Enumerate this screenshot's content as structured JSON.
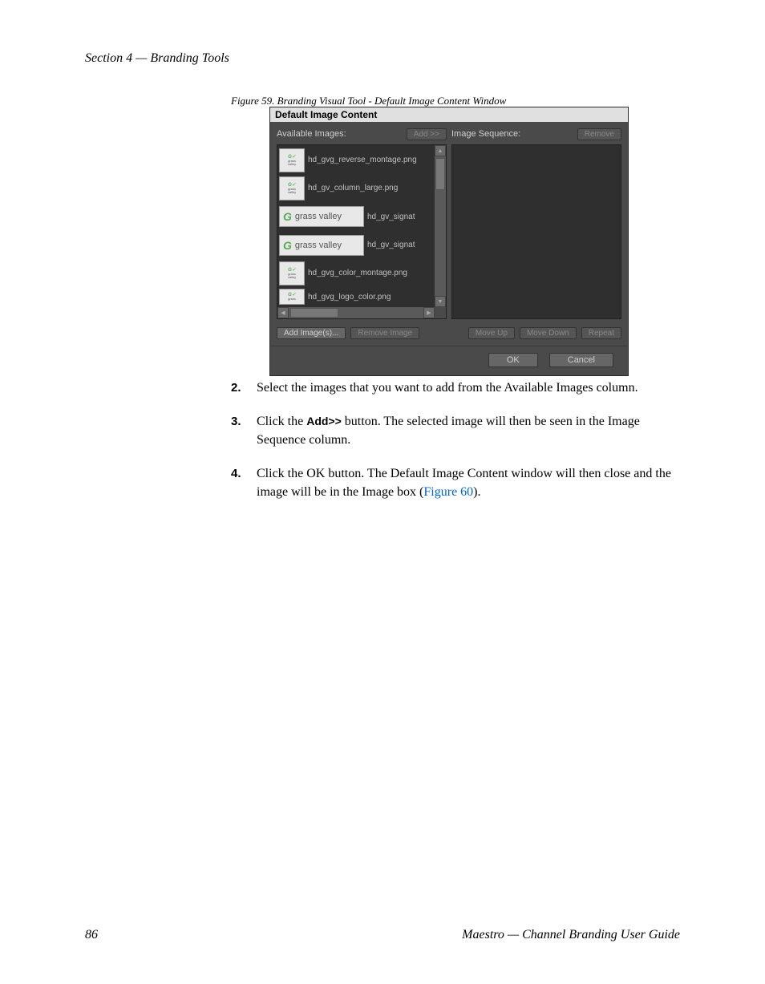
{
  "header": "Section 4 — Branding Tools",
  "figure_caption": "Figure 59.  Branding Visual Tool - Default Image Content Window",
  "dialog": {
    "title": "Default Image Content",
    "left": {
      "label": "Available Images:",
      "add_btn": "Add >>",
      "images": [
        {
          "name": "hd_gvg_reverse_montage.png",
          "style": "small"
        },
        {
          "name": "hd_gv_column_large.png",
          "style": "small"
        },
        {
          "name": "hd_gv_signat",
          "style": "wide",
          "brand": "grass valley"
        },
        {
          "name": "hd_gv_signat",
          "style": "wide",
          "brand": "grass valley"
        },
        {
          "name": "hd_gvg_color_montage.png",
          "style": "small"
        },
        {
          "name": "hd_gvg_logo_color.png",
          "style": "small"
        }
      ],
      "add_image_btn": "Add Image(s)...",
      "remove_image_btn": "Remove Image"
    },
    "right": {
      "label": "Image Sequence:",
      "remove_btn": "Remove",
      "move_up_btn": "Move Up",
      "move_down_btn": "Move Down",
      "repeat_btn": "Repeat"
    },
    "footer": {
      "ok": "OK",
      "cancel": "Cancel"
    }
  },
  "steps": [
    {
      "num": "2.",
      "text_a": "Select the images that you want to add from the Available Images column."
    },
    {
      "num": "3.",
      "text_a": "Click the ",
      "bold": "Add>>",
      "text_b": " button. The selected image will then be seen in the Image Sequence column."
    },
    {
      "num": "4.",
      "text_a": "Click the OK button. The Default Image Content window will then close and the image will be in the Image box (",
      "link": "Figure 60",
      "text_b": ")."
    }
  ],
  "footer": {
    "page": "86",
    "doc": "Maestro  —  Channel Branding User Guide"
  }
}
